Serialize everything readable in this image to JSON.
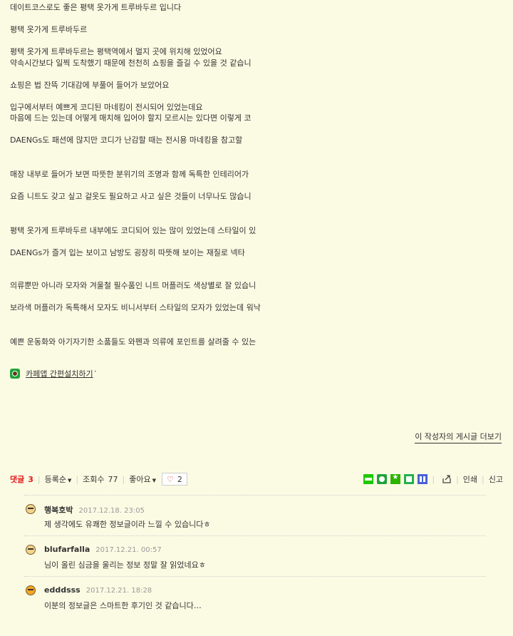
{
  "article": {
    "lines": [
      "데이트코스로도 좋은 평택 옷가게 트루바두르 입니다",
      "평택 옷가게 트루바두르",
      "평택 옷가게 트루바두르는 평택역에서 멀지 곳에 위치해 있었어요",
      "약속시간보다 일찍 도착했기 때문에 천천히 쇼핑을 즐길 수 있을 것 같습니",
      "쇼핑은 법 잔뜩 기대감에 부풀어 들어가 보았어요",
      "입구에서부터 예쁘게 코디된 마네킹이 전시되어 있었는데요",
      "마음에 드는 있는데 어떻게 매치해 입어야 할지 모르시는 있다면 이렇게 코",
      "DAENGs도 패션에 많지만 코디가 난감할 때는 전시용 마네킹을 참고할",
      "매장 내부로 들어가 보면 따뜻한 분위기의 조명과 함께 독특한 인테리어가",
      "요즘 니트도 갖고 싶고 겉옷도 필요하고 사고 싶은 것들이 너무나도 많습니",
      "평택 옷가게 트루바두르 내부에도 코디되어 있는 많이 있었는데 스타일이 있",
      "DAENGs가 즐겨 입는 보이고 남방도 굉장히 따뜻해 보이는 재질로 넥타",
      "의류뿐만 아니라 모자와 겨울철 필수품인 니트 머플러도 색상별로 잘 있습니",
      "보라색 머플러가 독특해서 모자도 비니서부터 스타일의 모자가 있었는데 워낙",
      "예쁜 운동화와 아기자기한 소품들도 와펜과 의류에 포인트를 살려줄 수 있는"
    ]
  },
  "cafeapp": {
    "label": "카페앱 간편설치하기",
    "tick": "'"
  },
  "more_posts": "이 작성자의 게시글 더보기",
  "comment_bar": {
    "comment_label": "댓글",
    "comment_count": "3",
    "sort_label": "등록순",
    "views_label": "조회수",
    "views_count": "77",
    "like_label": "좋아요",
    "like_count": "2",
    "print_label": "인쇄",
    "report_label": "신고"
  },
  "share_icons": [
    "blog-icon",
    "cafe-icon",
    "bookmark-icon",
    "memo-icon",
    "band-icon",
    "share-icon"
  ],
  "comments": [
    {
      "author": "행복호박",
      "date": "2017.12.18. 23:05",
      "text": "제 생각에도 유쾌한 정보글이라 느낄 수 있습니다ㅎ"
    },
    {
      "author": "blufarfalla",
      "date": "2017.12.21. 00:57",
      "text": "님이 올린 심금을 울리는 정보 정말 잘 읽었네요ㅎ"
    },
    {
      "author": "edddsss",
      "date": "2017.12.21. 18:28",
      "text": "이분의 정보글은 스마트한 후기인 것 같습니다…"
    }
  ],
  "colors": {
    "background": "#fbfbe4",
    "accent_red": "#e0191a",
    "text": "#333333"
  }
}
